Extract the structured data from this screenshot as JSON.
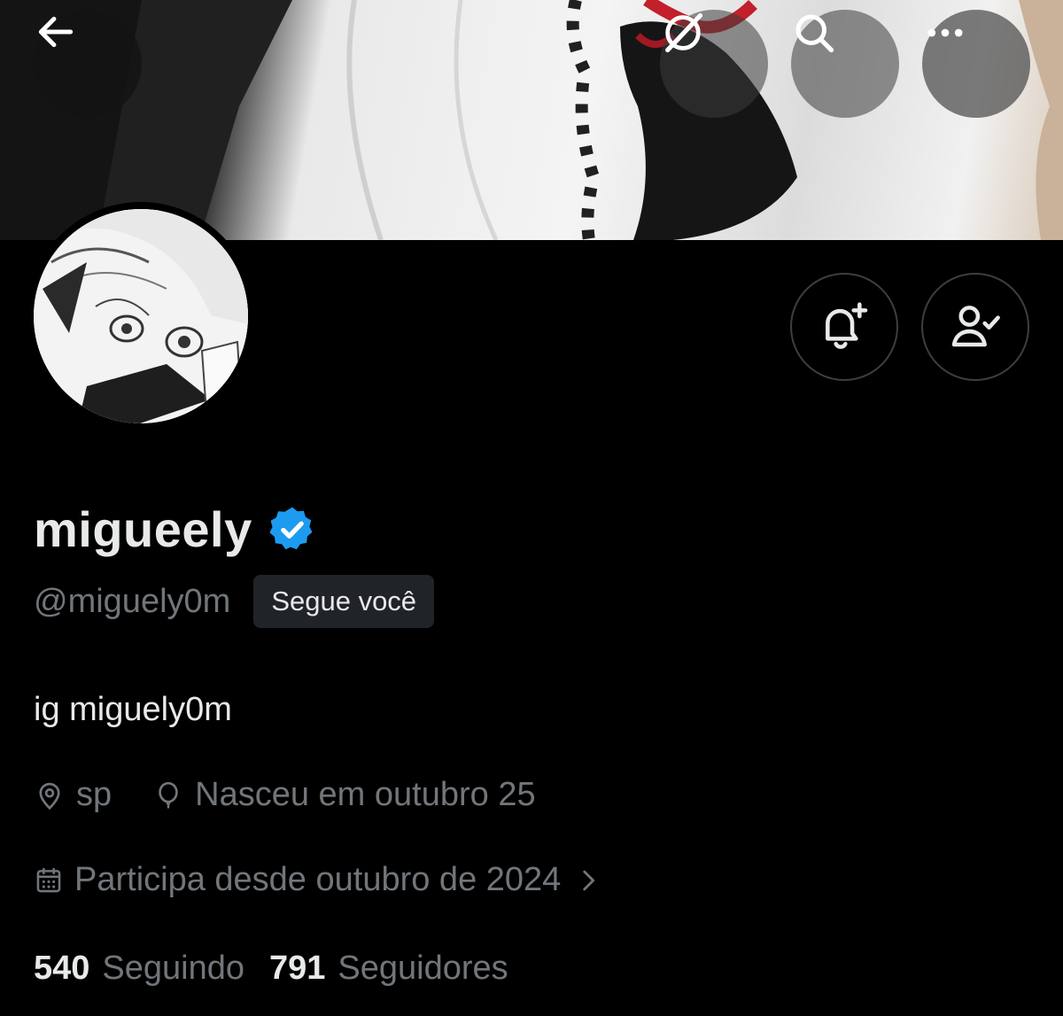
{
  "header": {
    "back_icon": "arrow-left-icon",
    "grok_icon": "grok-icon",
    "search_icon": "search-icon",
    "more_icon": "more-horizontal-icon"
  },
  "profile": {
    "display_name": "migueely",
    "verified": true,
    "verified_color": "#1d9bf0",
    "handle": "@miguely0m",
    "follows_you_label": "Segue você",
    "bio": "ig miguely0m",
    "location": "sp",
    "birthday": "Nasceu em outubro 25",
    "joined": "Participa desde outubro de 2024"
  },
  "actions": {
    "notify_icon": "bell-plus-icon",
    "following_icon": "person-check-icon"
  },
  "stats": {
    "following_count": "540",
    "following_label": "Seguindo",
    "followers_count": "791",
    "followers_label": "Seguidores"
  },
  "colors": {
    "background": "#000000",
    "text_primary": "#e7e9ea",
    "text_secondary": "#71767b",
    "badge_bg": "#202327",
    "accent": "#1d9bf0"
  }
}
